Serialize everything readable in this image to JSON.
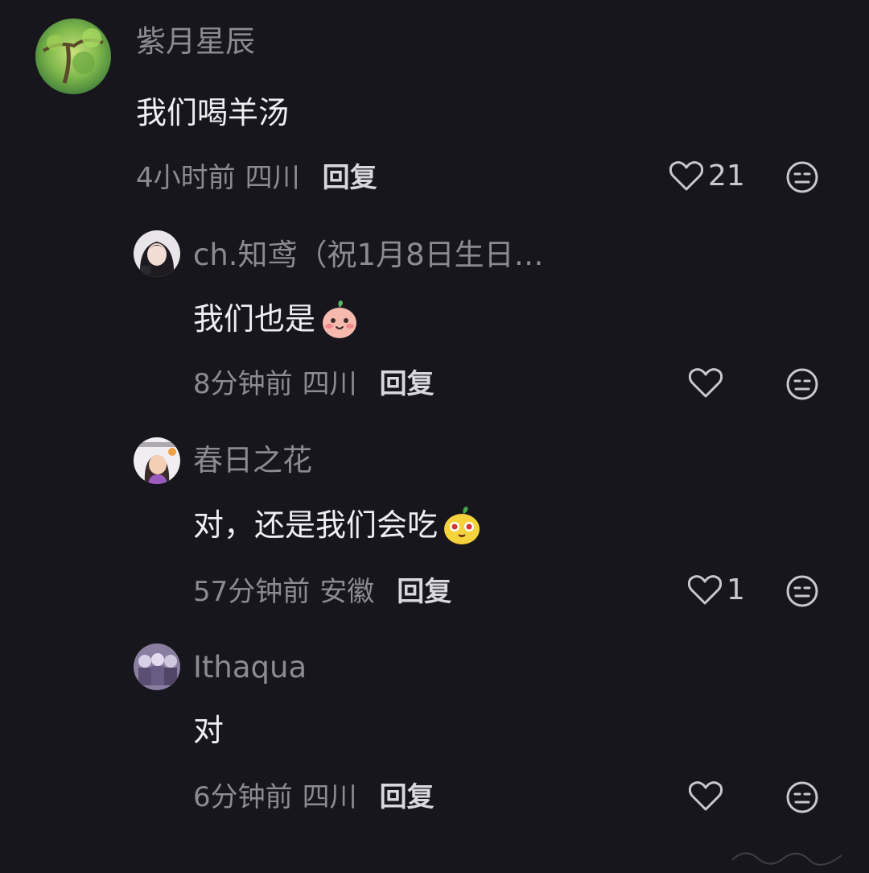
{
  "comments": [
    {
      "username": "紫月星辰",
      "content": "我们喝羊汤",
      "time": "4小时前",
      "location": "四川",
      "reply_label": "回复",
      "likes": "21",
      "avatar_icon": "landscape-avatar",
      "emoji": null
    },
    {
      "username": "ch.知鸢（祝1月8日生日…",
      "content": "我们也是",
      "time": "8分钟前",
      "location": "四川",
      "reply_label": "回复",
      "likes": "",
      "avatar_icon": "girl-portrait-avatar",
      "emoji": "blushing-peach-emoji"
    },
    {
      "username": "春日之花",
      "content": "对，还是我们会吃",
      "time": "57分钟前",
      "location": "安徽",
      "reply_label": "回复",
      "likes": "1",
      "avatar_icon": "cartoon-girl-avatar",
      "emoji": "drooling-bun-emoji"
    },
    {
      "username": "Ithaqua",
      "content": "对",
      "time": "6分钟前",
      "location": "四川",
      "reply_label": "回复",
      "likes": "",
      "avatar_icon": "purple-group-avatar",
      "emoji": null
    }
  ],
  "colors": {
    "background": "#16161c",
    "username": "#8c8b93",
    "content": "#efeef3",
    "reply": "#d9d8de"
  }
}
